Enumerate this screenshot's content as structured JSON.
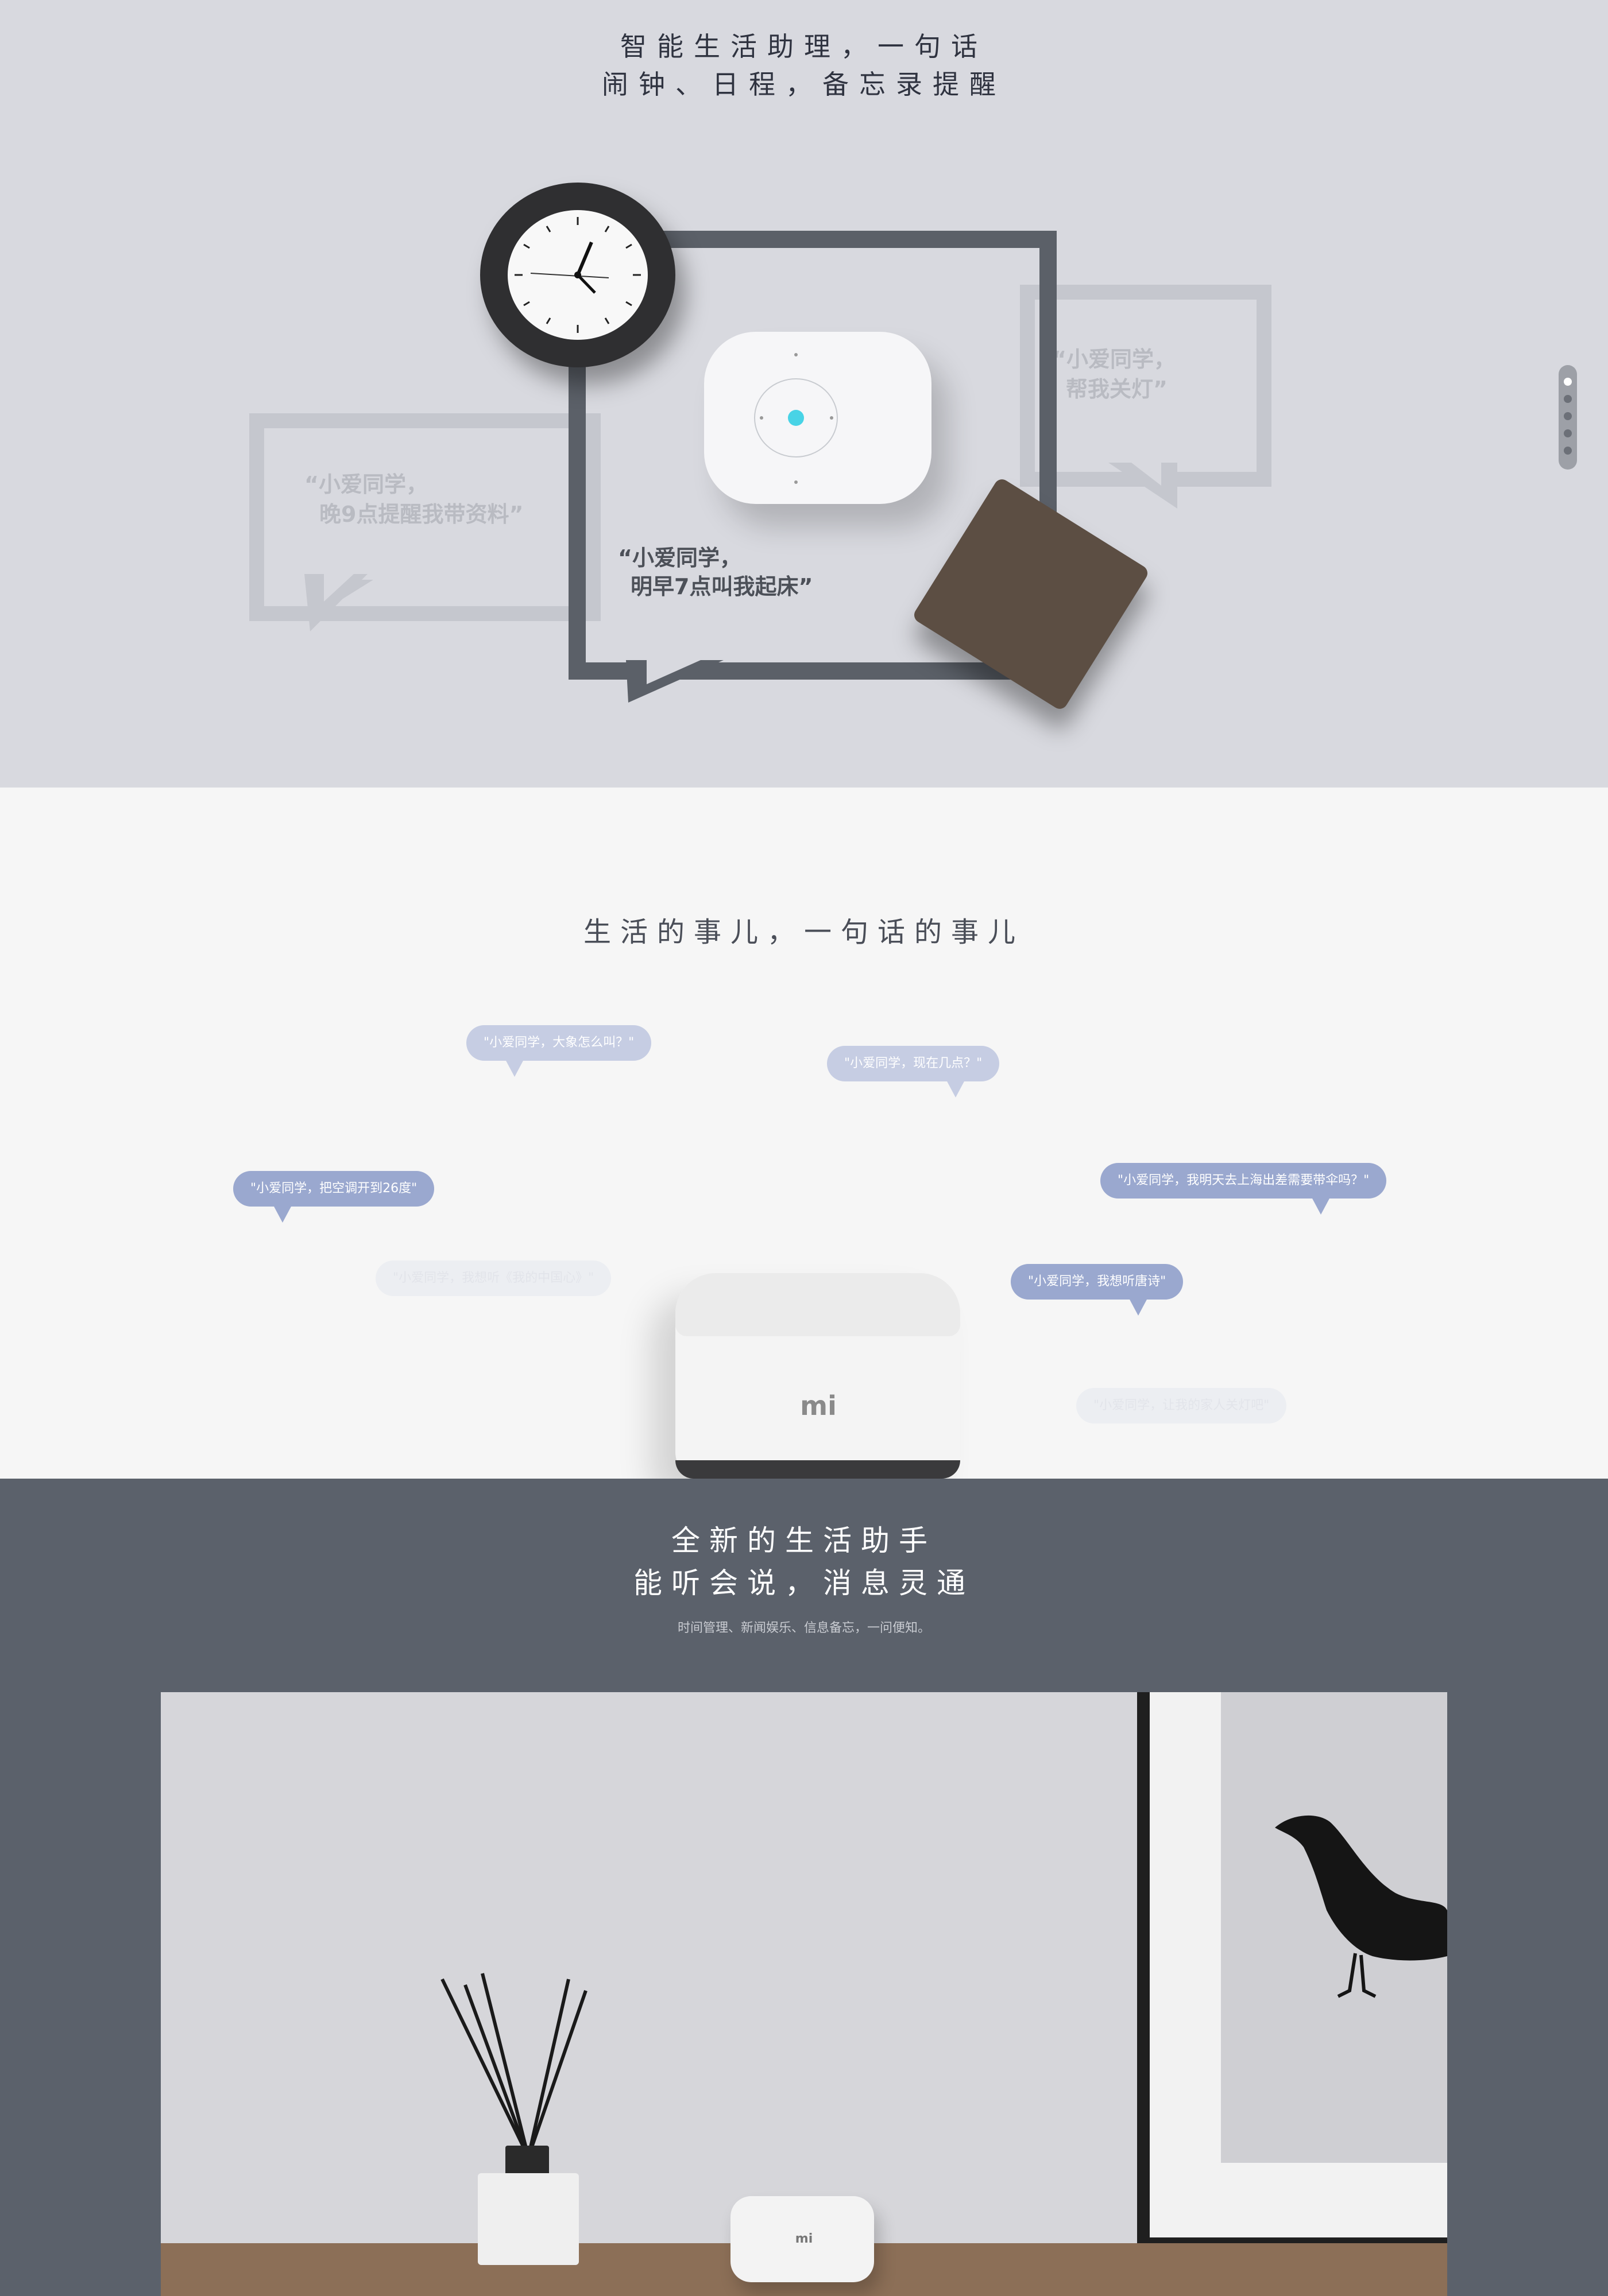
{
  "hero": {
    "headline_line1": "智能生活助理，一句话",
    "headline_line2": "闹钟、日程，备忘录提醒",
    "quote_main_line1": "“小爱同学，",
    "quote_main_line2": "明早7点叫我起床”",
    "quote_left_line1": "“小爱同学，",
    "quote_left_line2": "晚9点提醒我带资料”",
    "quote_right_line1": "“小爱同学，",
    "quote_right_line2": "帮我关灯”"
  },
  "pager": {
    "count": 5,
    "active_index": 0
  },
  "voice_section": {
    "title": "生活的事儿，一句话的事儿",
    "bubbles": [
      "\"小爱同学，大象怎么叫？\"",
      "\"小爱同学，现在几点？\"",
      "\"小爱同学，把空调开到26度\"",
      "\"小爱同学，我明天去上海出差需要带伞吗？\"",
      "\"小爱同学，我想听唐诗\"",
      "\"小爱同学，我想听《我的中国心》\"",
      "\"小爱同学，让我的家人关灯吧\""
    ],
    "speaker_logo": "mi"
  },
  "assistant_section": {
    "title_line1": "全新的生活助手",
    "title_line2": "能听会说，消息灵通",
    "subtitle": "时间管理、新闻娱乐、信息备忘，一问便知。",
    "speaker_logo": "mi"
  },
  "colors": {
    "hero_bg": "#d8d9df",
    "frame_dark": "#5b6068",
    "bubble_mid": "#9aa8cf",
    "bubble_light": "#c6cde3",
    "section3_bg": "#5b616b"
  }
}
